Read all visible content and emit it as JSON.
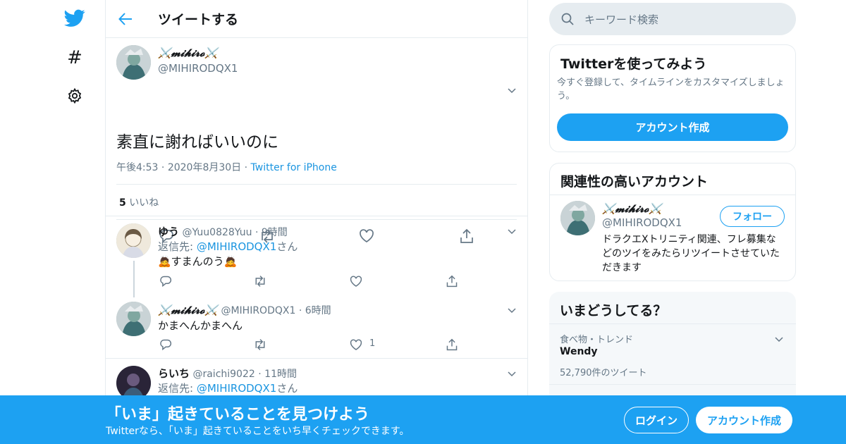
{
  "colors": {
    "accent": "#1da1f2",
    "link": "#1b95e0",
    "muted": "#657786",
    "text": "#14171a",
    "border": "#e6ecf0"
  },
  "nav": {
    "icons": [
      "twitter-bird-icon",
      "hashtag-icon",
      "gear-icon"
    ]
  },
  "header": {
    "title": "ツイートする",
    "back_icon": "arrow-left-icon"
  },
  "tweet": {
    "display_name": "⚔️𝓶𝓲𝓱𝓲𝓻𝓸⚔️",
    "handle": "@MIHIRODQX1",
    "text": "素直に謝ればいいのに",
    "time": "午後4:53",
    "date": "2020年8月30日",
    "source": "Twitter for iPhone",
    "likes_count": "5",
    "likes_label": "いいね"
  },
  "replies": [
    {
      "name": "ゆう",
      "handle": "@Yuu0828Yuu",
      "time": "9時間",
      "reply_to_prefix": "返信先: ",
      "reply_to_handle": "@MIHIRODQX1",
      "reply_to_suffix": "さん",
      "text": "🙇すまんのう🙇"
    },
    {
      "name": "⚔️𝓶𝓲𝓱𝓲𝓻𝓸⚔️",
      "handle": "@MIHIRODQX1",
      "time": "6時間",
      "text": "かまへんかまへん",
      "like_count": "1"
    },
    {
      "name": "らいち",
      "handle": "@raichi9022",
      "time": "11時間",
      "reply_to_prefix": "返信先: ",
      "reply_to_handle": "@MIHIRODQX1",
      "reply_to_suffix": "さん"
    }
  ],
  "search": {
    "placeholder": "キーワード検索"
  },
  "signup_card": {
    "title": "Twitterを使ってみよう",
    "description": "今すぐ登録して、タイムラインをカスタマイズしましょう。",
    "button": "アカウント作成"
  },
  "related": {
    "title": "関連性の高いアカウント",
    "name": "⚔️𝓶𝓲𝓱𝓲𝓻𝓸⚔️",
    "handle": "@MIHIRODQX1",
    "follow": "フォロー",
    "bio": "ドラクエXトリニティ関連、フレ募集などのツイをみたらリツイートさせていただきます"
  },
  "trends": {
    "title": "いまどうしてる？",
    "items": [
      {
        "category": "食べ物・トレンド",
        "name": "Wendy",
        "count": "52,790件のツイート"
      }
    ]
  },
  "bottom_bar": {
    "title": "「いま」起きていることを見つけよう",
    "subtitle": "Twitterなら、「いま」起きていることをいち早くチェックできます。",
    "login": "ログイン",
    "signup": "アカウント作成"
  }
}
